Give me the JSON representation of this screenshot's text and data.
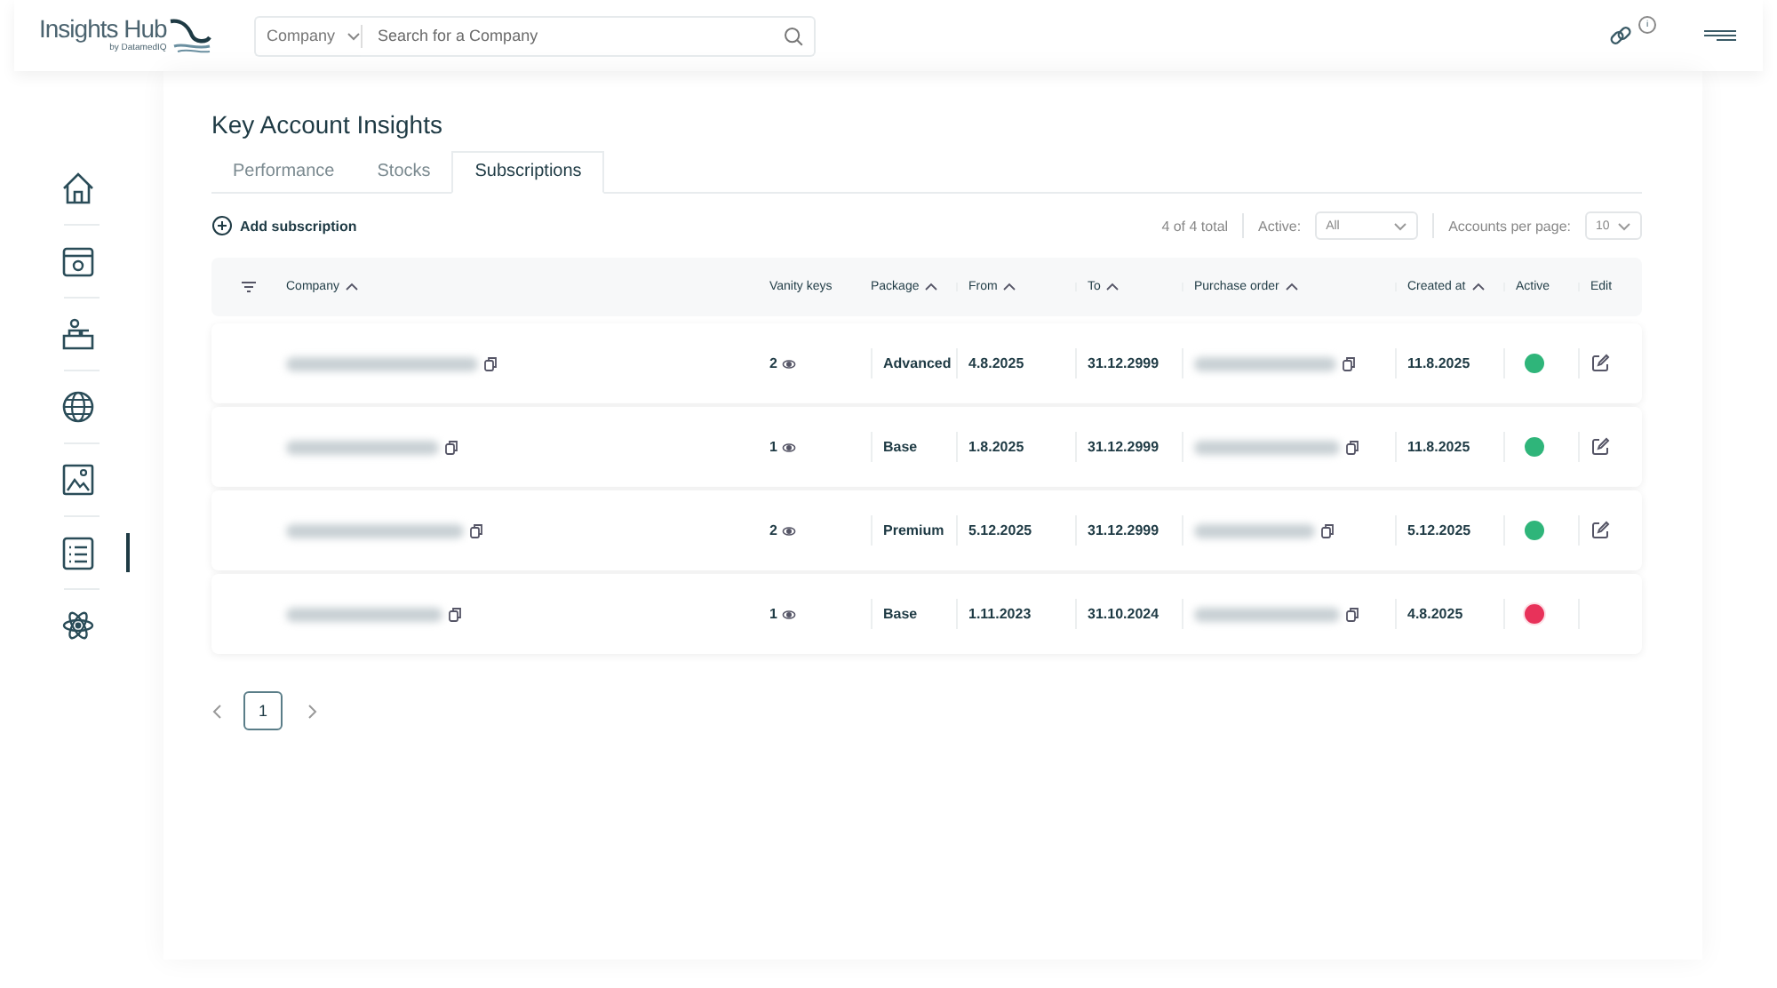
{
  "header": {
    "logo": {
      "title": "Insights Hub",
      "subtitle": "by DatamedIQ"
    },
    "search": {
      "scope": "Company",
      "placeholder": "Search for a Company"
    },
    "link_badge": "i"
  },
  "sidebar": {
    "items": [
      {
        "selected": false
      },
      {
        "selected": false
      },
      {
        "selected": false
      },
      {
        "selected": false
      },
      {
        "selected": false
      },
      {
        "selected": true
      },
      {
        "selected": false
      }
    ]
  },
  "page": {
    "title": "Key Account Insights"
  },
  "tabs": [
    {
      "label": "Performance",
      "selected": false
    },
    {
      "label": "Stocks",
      "selected": false
    },
    {
      "label": "Subscriptions",
      "selected": true
    }
  ],
  "toolbar": {
    "add_label": "Add subscription",
    "total": "4 of 4 total",
    "active_label": "Active:",
    "active_value": "All",
    "per_page_label": "Accounts per page:",
    "per_page_value": "10"
  },
  "table": {
    "columns": [
      {
        "label": "Company",
        "sortable": true
      },
      {
        "label": "Vanity keys",
        "sortable": false
      },
      {
        "label": "Package",
        "sortable": true
      },
      {
        "label": "From",
        "sortable": true
      },
      {
        "label": "To",
        "sortable": true
      },
      {
        "label": "Purchase order",
        "sortable": true
      },
      {
        "label": "Created at",
        "sortable": true
      },
      {
        "label": "Active",
        "sortable": false
      },
      {
        "label": "Edit",
        "sortable": false
      }
    ],
    "rows": [
      {
        "vanity_keys": "2",
        "package": "Advanced",
        "from": "4.8.2025",
        "to": "31.12.2999",
        "created_at": "11.8.2025",
        "active": true,
        "color": "#2fb57a",
        "editable": true
      },
      {
        "vanity_keys": "1",
        "package": "Base",
        "from": "1.8.2025",
        "to": "31.12.2999",
        "created_at": "11.8.2025",
        "active": true,
        "color": "#2fb57a",
        "editable": true
      },
      {
        "vanity_keys": "2",
        "package": "Premium",
        "from": "5.12.2025",
        "to": "31.12.2999",
        "created_at": "5.12.2025",
        "active": true,
        "color": "#2fb57a",
        "editable": true
      },
      {
        "vanity_keys": "1",
        "package": "Base",
        "from": "1.11.2023",
        "to": "31.10.2024",
        "created_at": "4.8.2025",
        "active": false,
        "color": "#e8325a",
        "editable": false
      }
    ]
  },
  "pagination": {
    "pages": [
      {
        "label": "1",
        "selected": true
      }
    ]
  }
}
